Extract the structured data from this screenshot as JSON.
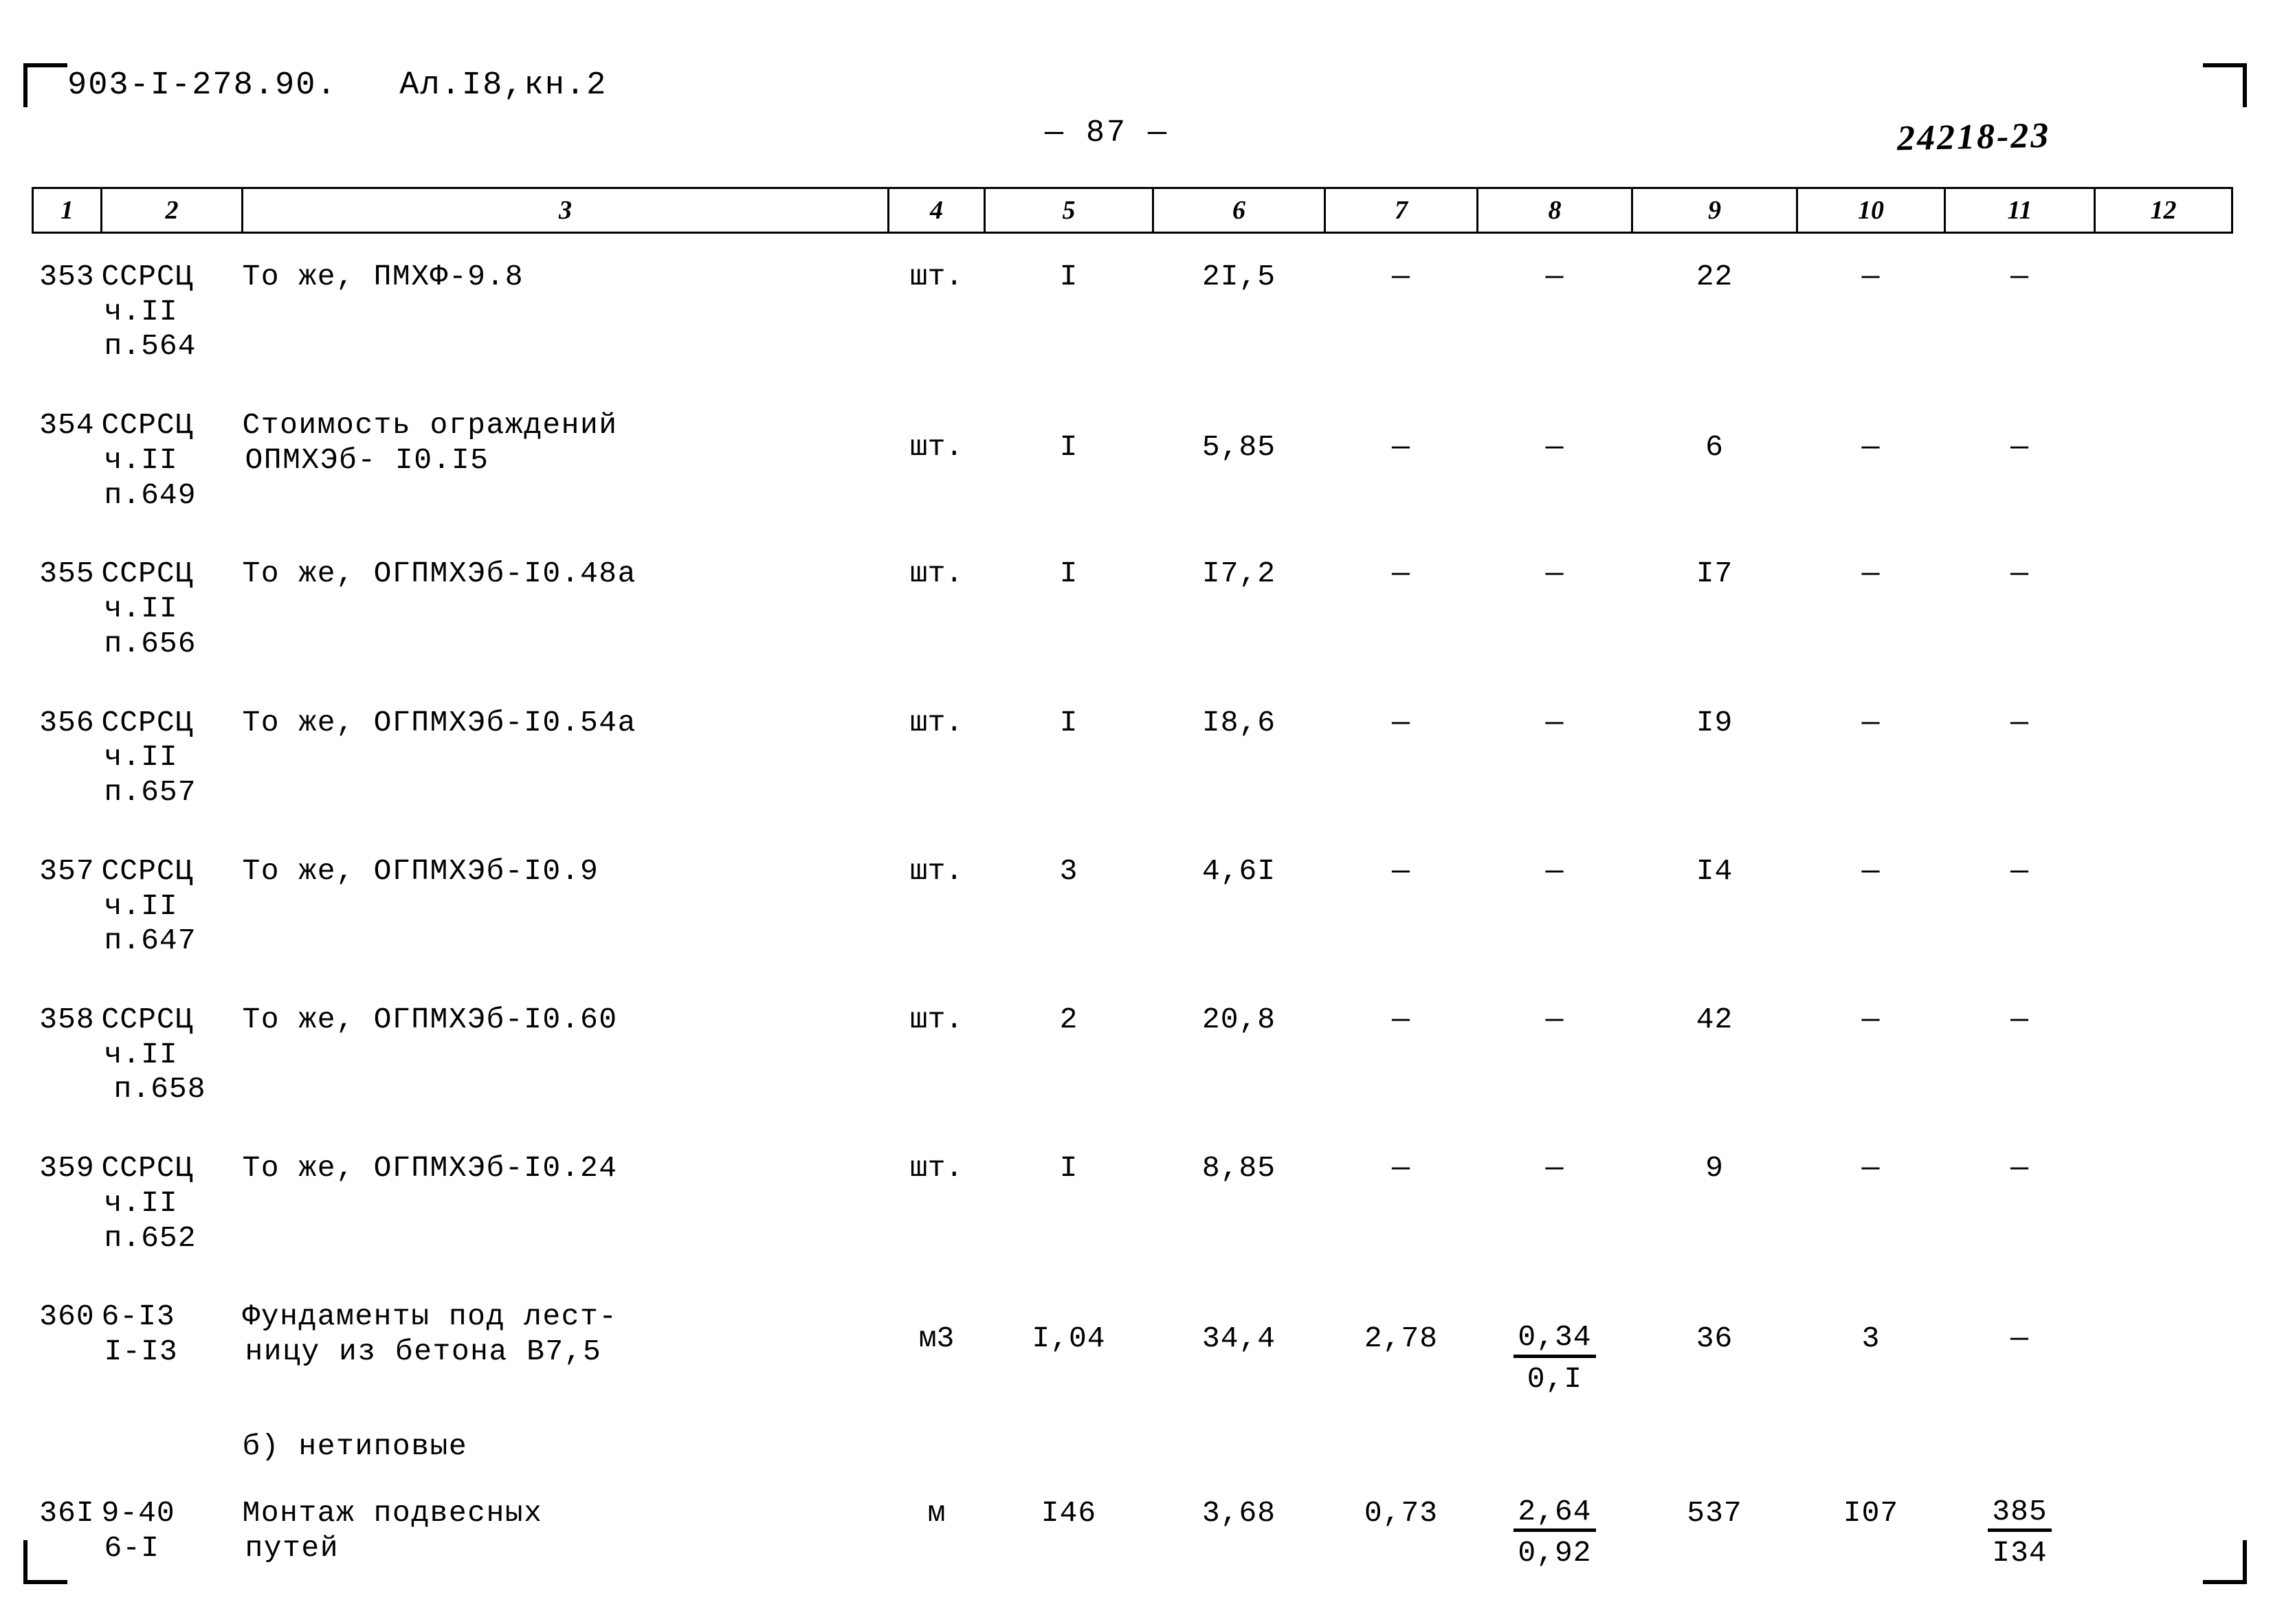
{
  "header": {
    "doc_code": "903-I-278.90.   Ал.I8,кн.2",
    "page_number": "— 87 —",
    "stamp_code": "24218-23"
  },
  "table": {
    "column_numbers": [
      "1",
      "2",
      "3",
      "4",
      "5",
      "6",
      "7",
      "8",
      "9",
      "10",
      "11",
      "12"
    ],
    "rows": [
      {
        "c1": "353",
        "c2_line1": "ССРСЦ",
        "c2_line2": "ч.II",
        "c2_line3": "п.564",
        "c3": "То же, ПМХФ-9.8",
        "c4": "шт.",
        "c5": "I",
        "c6": "2I,5",
        "c7": "—",
        "c8": "—",
        "c9": "22",
        "c10": "—",
        "c11": "—",
        "c12": ""
      },
      {
        "c1": "354",
        "c2_line1": "ССРСЦ",
        "c2_line2": "ч.II",
        "c2_line3": "п.649",
        "c3": "Стоимость ограждений",
        "c3_line2": "ОПМХЭб- I0.I5",
        "c4": "шт.",
        "c5": "I",
        "c6": "5,85",
        "c7": "—",
        "c8": "—",
        "c9": "6",
        "c10": "—",
        "c11": "—",
        "c12": ""
      },
      {
        "c1": "355",
        "c2_line1": "ССРСЦ",
        "c2_line2": "ч.II",
        "c2_line3": "п.656",
        "c3": "То же, ОГПМХЭб-I0.48а",
        "c4": "шт.",
        "c5": "I",
        "c6": "I7,2",
        "c7": "—",
        "c8": "—",
        "c9": "I7",
        "c10": "—",
        "c11": "—",
        "c12": ""
      },
      {
        "c1": "356",
        "c2_line1": "ССРСЦ",
        "c2_line2": "ч.II",
        "c2_line3": "п.657",
        "c3": "То же, ОГПМХЭб-I0.54а",
        "c4": "шт.",
        "c5": "I",
        "c6": "I8,6",
        "c7": "—",
        "c8": "—",
        "c9": "I9",
        "c10": "—",
        "c11": "—",
        "c12": ""
      },
      {
        "c1": "357",
        "c2_line1": "ССРСЦ",
        "c2_line2": "ч.II",
        "c2_line3": "п.647",
        "c3": "То же, ОГПМХЭб-I0.9",
        "c4": "шт.",
        "c5": "3",
        "c6": "4,6I",
        "c7": "—",
        "c8": "—",
        "c9": "I4",
        "c10": "—",
        "c11": "—",
        "c12": ""
      },
      {
        "c1": "358",
        "c2_line1": "ССРСЦ",
        "c2_line2": "ч.II",
        "c2_line3": "п.658",
        "c3": "То же, ОГПМХЭб-I0.60",
        "c4": "шт.",
        "c5": "2",
        "c6": "20,8",
        "c7": "—",
        "c8": "—",
        "c9": "42",
        "c10": "—",
        "c11": "—",
        "c12": ""
      },
      {
        "c1": "359",
        "c2_line1": "ССРСЦ",
        "c2_line2": "ч.II",
        "c2_line3": "п.652",
        "c3": "То же, ОГПМХЭб-I0.24",
        "c4": "шт.",
        "c5": "I",
        "c6": "8,85",
        "c7": "—",
        "c8": "—",
        "c9": "9",
        "c10": "—",
        "c11": "—",
        "c12": ""
      },
      {
        "c1": "360",
        "c2_line1": "6-I3",
        "c2_line2": "I-I3",
        "c2_line3": "",
        "c3": "Фундаменты под лест-",
        "c3_line2": "ницу из бетона В7,5",
        "c4": "м3",
        "c5": "I,04",
        "c6": "34,4",
        "c7": "2,78",
        "c8_top": "0,34",
        "c8_bot": "0,I",
        "c9": "36",
        "c10": "3",
        "c11": "—",
        "c12": ""
      },
      {
        "c1": "36I",
        "c2_line1": "9-40",
        "c2_line2": "6-I",
        "c2_line3": "",
        "c3": "Монтаж подвесных",
        "c3_line2": "путей",
        "c4": "м",
        "c5": "I46",
        "c6": "3,68",
        "c7": "0,73",
        "c8_top": "2,64",
        "c8_bot": "0,92",
        "c9": "537",
        "c10": "I07",
        "c11_top": "385",
        "c11_bot": "I34",
        "c12": ""
      }
    ],
    "section_note": "б)  нетиповые"
  }
}
